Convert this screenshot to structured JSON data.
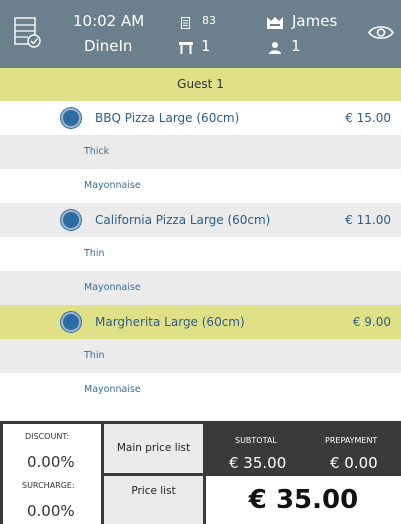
{
  "header": {
    "time": "10:02 AM",
    "order_type": "DineIn",
    "order_number": "83",
    "table_number": "1",
    "waiter_name": "James",
    "guest_count": "1"
  },
  "guest": {
    "label": "Guest 1"
  },
  "items": [
    {
      "name": "BBQ Pizza Large (60cm)",
      "price": "€ 15.00",
      "modifiers": [
        "Thick",
        "Mayonnaise"
      ],
      "selected": false
    },
    {
      "name": "California Pizza Large (60cm)",
      "price": "€ 11.00",
      "modifiers": [
        "Thin",
        "Mayonnaise"
      ],
      "selected": false
    },
    {
      "name": "Margherita Large (60cm)",
      "price": "€ 9.00",
      "modifiers": [
        "Thin",
        "Mayonnaise"
      ],
      "selected": true
    }
  ],
  "footer": {
    "discount_label": "DISCOUNT:",
    "discount_value": "0.00%",
    "surcharge_label": "SURCHARGE:",
    "surcharge_value": "0.00%",
    "main_price_list_label": "Main price list",
    "price_list_label": "Price list",
    "subtotal_label": "SUBTOTAL",
    "subtotal_value": "€ 35.00",
    "prepayment_label": "PREPAYMENT",
    "prepayment_value": "€ 0.00",
    "total_value": "€ 35.00"
  },
  "colors": {
    "header_bg": "#6b7f8c",
    "accent_yellow": "#dfe088",
    "item_text": "#2b5d8c",
    "footer_dark": "#3a3a3a"
  },
  "icons": [
    "order-list-icon",
    "receipt-icon",
    "table-icon",
    "crown-icon",
    "person-icon",
    "eye-icon"
  ]
}
